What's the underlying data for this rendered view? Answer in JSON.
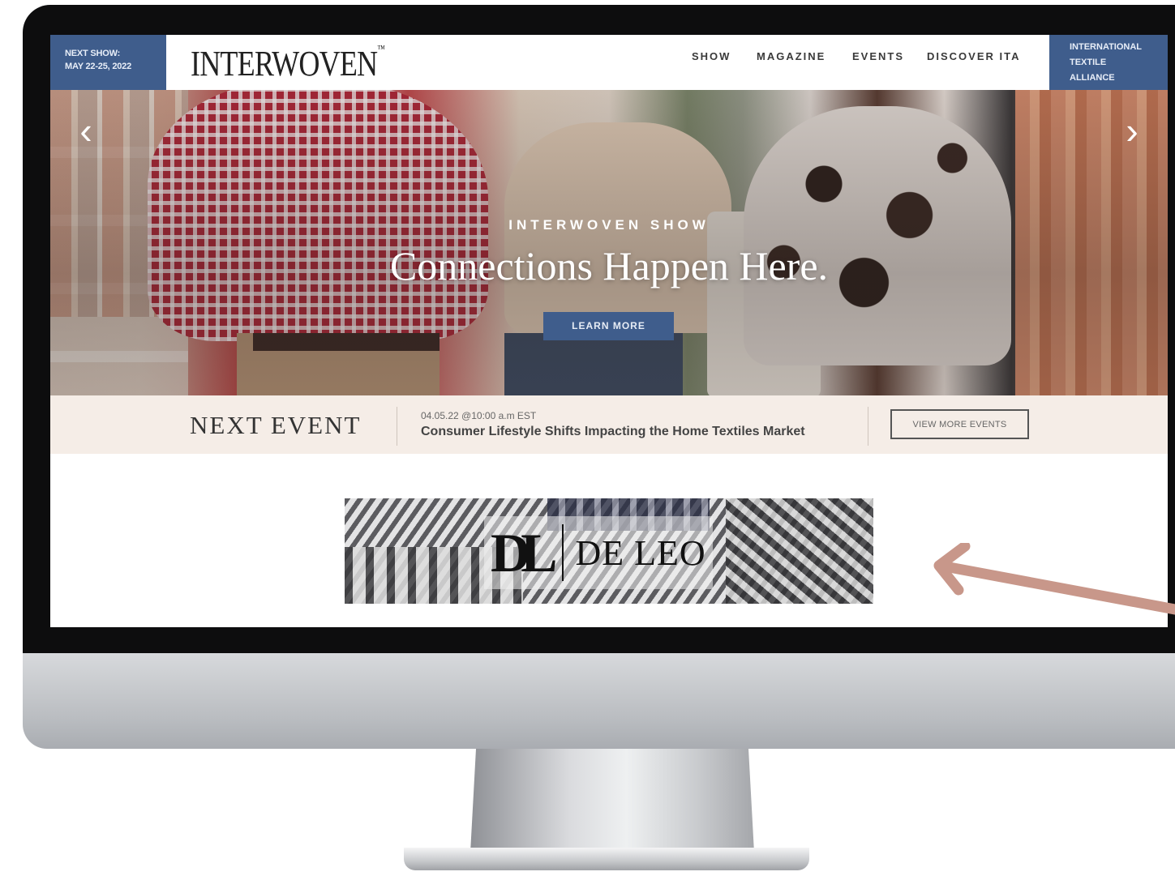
{
  "header": {
    "next_show_label": "NEXT SHOW:",
    "next_show_dates": "MAY 22-25, 2022",
    "logo": "INTERWOVEN",
    "logo_mark": "™",
    "nav": [
      "SHOW",
      "MAGAZINE",
      "EVENTS",
      "DISCOVER ITA"
    ],
    "ita_lines": [
      "INTERNATIONAL",
      "TEXTILE",
      "ALLIANCE"
    ]
  },
  "hero": {
    "eyebrow": "INTERWOVEN SHOW",
    "title": "Connections Happen Here.",
    "cta_label": "LEARN MORE",
    "prev_glyph": "‹",
    "next_glyph": "›"
  },
  "next_event": {
    "heading": "NEXT EVENT",
    "date": "04.05.22 @10:00 a.m EST",
    "title": "Consumer Lifestyle Shifts Impacting the Home Textiles Market",
    "button_label": "VIEW MORE EVENTS"
  },
  "ad": {
    "monogram": "DL",
    "name": "DE LEO"
  },
  "colors": {
    "brand_blue": "#3f5d8c",
    "event_bar": "#f5ede7",
    "annotation_arrow": "#c8978a"
  }
}
